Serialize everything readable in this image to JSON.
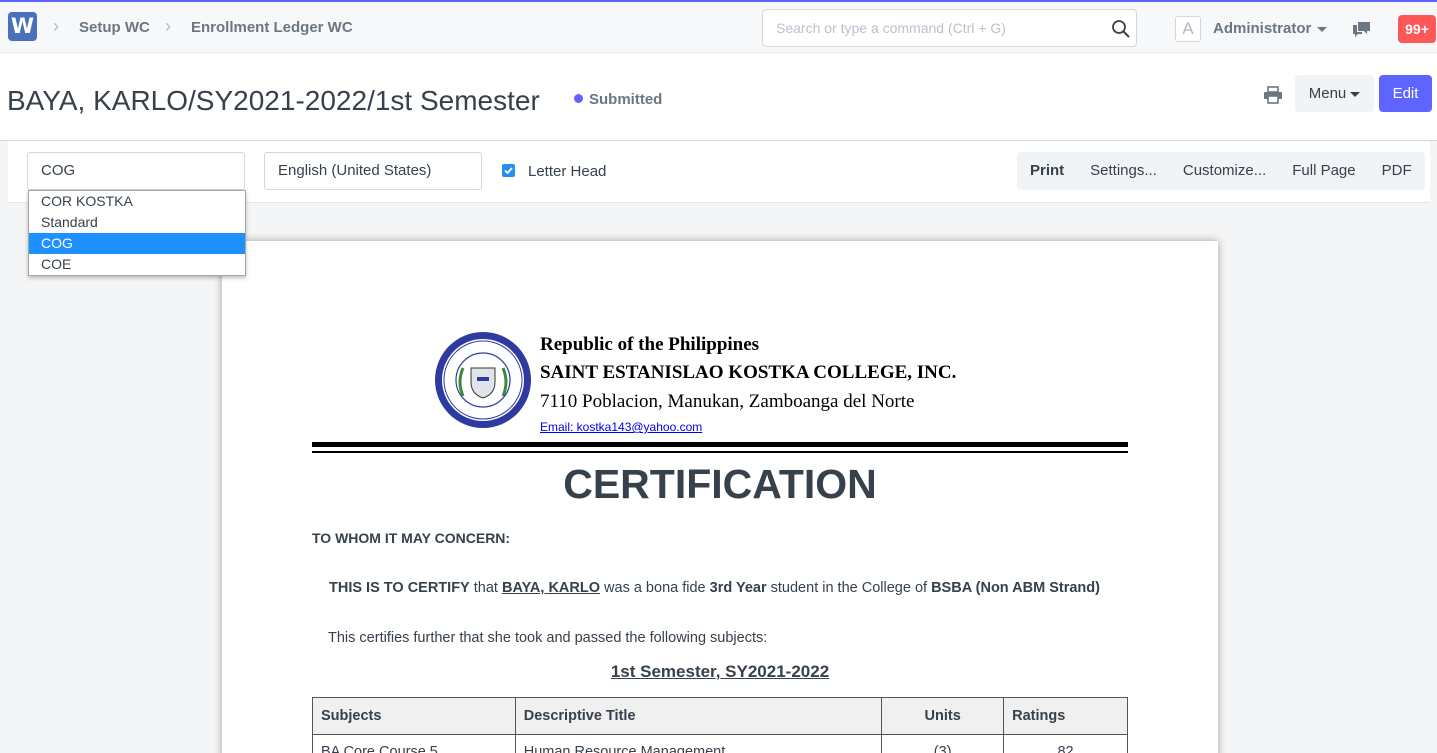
{
  "navbar": {
    "logo_letter": "W",
    "breadcrumbs": [
      "Setup WC",
      "Enrollment Ledger WC"
    ],
    "search_placeholder": "Search or type a command (Ctrl + G)",
    "avatar_letter": "A",
    "user": "Administrator",
    "notifications": "99+"
  },
  "header": {
    "title": "BAYA, KARLO/SY2021-2022/1st Semester",
    "status": "Submitted",
    "menu_label": "Menu",
    "edit_label": "Edit"
  },
  "print_toolbar": {
    "format_value": "COG",
    "format_options": [
      "COR KOSTKA",
      "Standard",
      "COG",
      "COE"
    ],
    "selected_option": "COG",
    "language": "English (United States)",
    "letter_head_label": "Letter Head",
    "letter_head_checked": true,
    "buttons": [
      "Print",
      "Settings...",
      "Customize...",
      "Full Page",
      "PDF"
    ]
  },
  "document": {
    "letterhead": {
      "line1": "Republic of the Philippines",
      "line2": "SAINT ESTANISLAO KOSTKA COLLEGE, INC.",
      "line3": "7110 Poblacion, Manukan, Zamboanga del Norte",
      "email": "Email: kostka143@yahoo.com"
    },
    "title": "CERTIFICATION",
    "salutation": "TO WHOM IT MAY CONCERN:",
    "certify": {
      "lead": "THIS IS TO CERTIFY",
      "t1": " that ",
      "name": "BAYA, KARLO",
      "t2": " was a bona fide ",
      "year": "3rd Year",
      "t3": " student in the College of ",
      "program": "BSBA (Non ABM Strand)"
    },
    "further": "This certifies further that she took and passed the following subjects:",
    "semester": "1st Semester, SY2021-2022",
    "table": {
      "headers": [
        "Subjects",
        "Descriptive Title",
        "Units",
        "Ratings"
      ],
      "rows": [
        [
          "BA Core Course 5",
          "Human Resource Management",
          "(3)",
          "82"
        ]
      ]
    }
  }
}
